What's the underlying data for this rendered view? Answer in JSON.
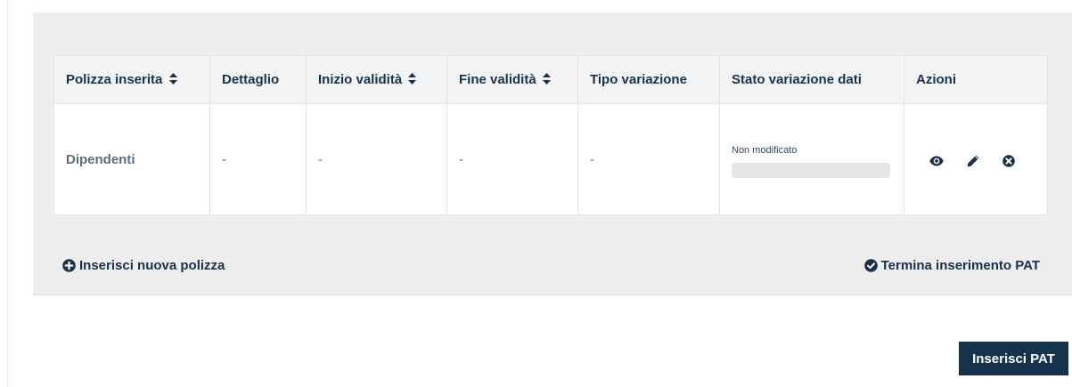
{
  "table": {
    "headers": {
      "polizza": "Polizza inserita",
      "dettaglio": "Dettaglio",
      "inizio": "Inizio validità",
      "fine": "Fine validità",
      "tipo": "Tipo variazione",
      "stato": "Stato variazione dati",
      "azioni": "Azioni"
    },
    "rows": [
      {
        "polizza": "Dipendenti",
        "dettaglio": "-",
        "inizio": "-",
        "fine": "-",
        "tipo": "-",
        "stato": "Non modificato"
      }
    ]
  },
  "icons": {
    "sort": "sort-icon",
    "view": "eye-icon",
    "edit": "pencil-icon",
    "delete": "times-circle-icon",
    "add": "plus-circle-icon",
    "done": "check-circle-icon"
  },
  "links": {
    "new_policy": "Inserisci nuova polizza",
    "end_pat": "Termina inserimento PAT"
  },
  "buttons": {
    "inserisci_pat": "Inserisci PAT"
  },
  "colors": {
    "primary": "#17324d",
    "panel_bg": "#eeeeee",
    "header_bg": "#f3f4f5"
  }
}
